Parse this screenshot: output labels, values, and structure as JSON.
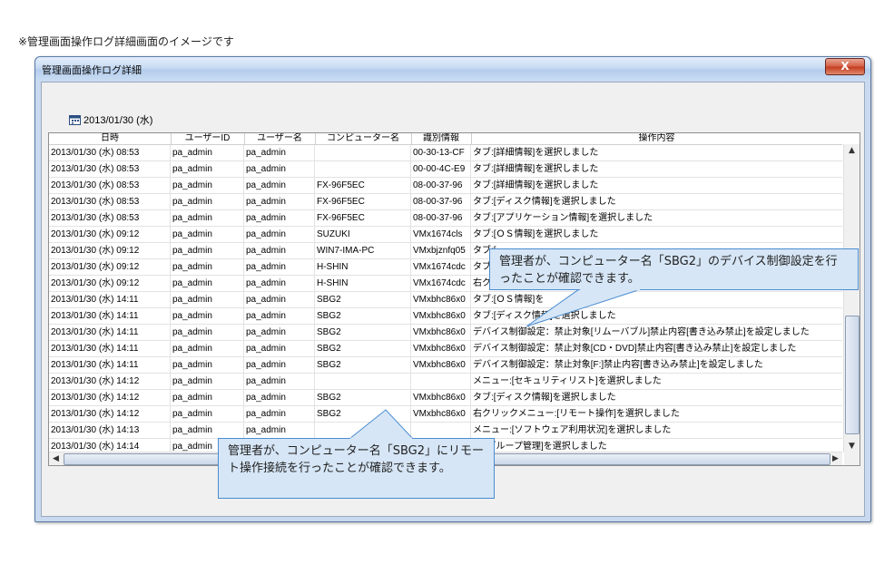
{
  "caption": "※管理画面操作ログ詳細画面のイメージです",
  "window": {
    "title": "管理画面操作ログ詳細",
    "close_label": "X"
  },
  "date_label": "2013/01/30 (水)",
  "columns": [
    "日時",
    "ユーザーID",
    "ユーザー名",
    "コンピューター名",
    "識別情報",
    "操作内容"
  ],
  "rows": [
    [
      "2013/01/30 (水) 08:53",
      "pa_admin",
      "pa_admin",
      "",
      "00-30-13-CF",
      "タブ:[詳細情報]を選択しました"
    ],
    [
      "2013/01/30 (水) 08:53",
      "pa_admin",
      "pa_admin",
      "",
      "00-00-4C-E9",
      "タブ:[詳細情報]を選択しました"
    ],
    [
      "2013/01/30 (水) 08:53",
      "pa_admin",
      "pa_admin",
      "FX-96F5EC",
      "08-00-37-96",
      "タブ:[詳細情報]を選択しました"
    ],
    [
      "2013/01/30 (水) 08:53",
      "pa_admin",
      "pa_admin",
      "FX-96F5EC",
      "08-00-37-96",
      "タブ:[ディスク情報]を選択しました"
    ],
    [
      "2013/01/30 (水) 08:53",
      "pa_admin",
      "pa_admin",
      "FX-96F5EC",
      "08-00-37-96",
      "タブ:[アプリケーション情報]を選択しました"
    ],
    [
      "2013/01/30 (水) 09:12",
      "pa_admin",
      "pa_admin",
      "SUZUKI",
      "VMx1674cls",
      "タブ:[ＯＳ情報]を選択しました"
    ],
    [
      "2013/01/30 (水) 09:12",
      "pa_admin",
      "pa_admin",
      "WIN7-IMA-PC",
      "VMxbjznfq05",
      "タブ:["
    ],
    [
      "2013/01/30 (水) 09:12",
      "pa_admin",
      "pa_admin",
      "H-SHIN",
      "VMx1674cdc",
      "タブ:["
    ],
    [
      "2013/01/30 (水) 09:12",
      "pa_admin",
      "pa_admin",
      "H-SHIN",
      "VMx1674cdc",
      "右クリ"
    ],
    [
      "2013/01/30 (水) 14:11",
      "pa_admin",
      "pa_admin",
      "SBG2",
      "VMxbhc86x0",
      "タブ:[ＯＳ情報]を"
    ],
    [
      "2013/01/30 (水) 14:11",
      "pa_admin",
      "pa_admin",
      "SBG2",
      "VMxbhc86x0",
      "タブ:[ディスク情報]を選択しました"
    ],
    [
      "2013/01/30 (水) 14:11",
      "pa_admin",
      "pa_admin",
      "SBG2",
      "VMxbhc86x0",
      "デバイス制御設定：禁止対象[リムーバブル]禁止内容[書き込み禁止]を設定しました"
    ],
    [
      "2013/01/30 (水) 14:11",
      "pa_admin",
      "pa_admin",
      "SBG2",
      "VMxbhc86x0",
      "デバイス制御設定：禁止対象[CD・DVD]禁止内容[書き込み禁止]を設定しました"
    ],
    [
      "2013/01/30 (水) 14:11",
      "pa_admin",
      "pa_admin",
      "SBG2",
      "VMxbhc86x0",
      "デバイス制御設定：禁止対象[F:]禁止内容[書き込み禁止]を設定しました"
    ],
    [
      "2013/01/30 (水) 14:12",
      "pa_admin",
      "pa_admin",
      "",
      "",
      "メニュー:[セキュリティリスト]を選択しました"
    ],
    [
      "2013/01/30 (水) 14:12",
      "pa_admin",
      "pa_admin",
      "SBG2",
      "VMxbhc86x0",
      "タブ:[ディスク情報]を選択しました"
    ],
    [
      "2013/01/30 (水) 14:12",
      "pa_admin",
      "pa_admin",
      "SBG2",
      "VMxbhc86x0",
      "右クリックメニュー:[リモート操作]を選択しました"
    ],
    [
      "2013/01/30 (水) 14:13",
      "pa_admin",
      "pa_admin",
      "",
      "",
      "メニュー:[ソフトウェア利用状況]を選択しました"
    ],
    [
      "2013/01/30 (水) 14:14",
      "pa_admin",
      "pa_admin",
      "",
      "",
      "ー:[グループ管理]を選択しました"
    ]
  ],
  "callouts": {
    "device_control": "管理者が、コンピューター名「SBG2」のデバイス制御設定を行ったことが確認できます。",
    "remote_operation": "管理者が、コンピューター名「SBG2」にリモート操作接続を行ったことが確認できます。"
  },
  "colors": {
    "callout_fill": "#d6e6f6",
    "callout_border": "#4a8cd0",
    "window_frame": "#c9d9ef"
  }
}
